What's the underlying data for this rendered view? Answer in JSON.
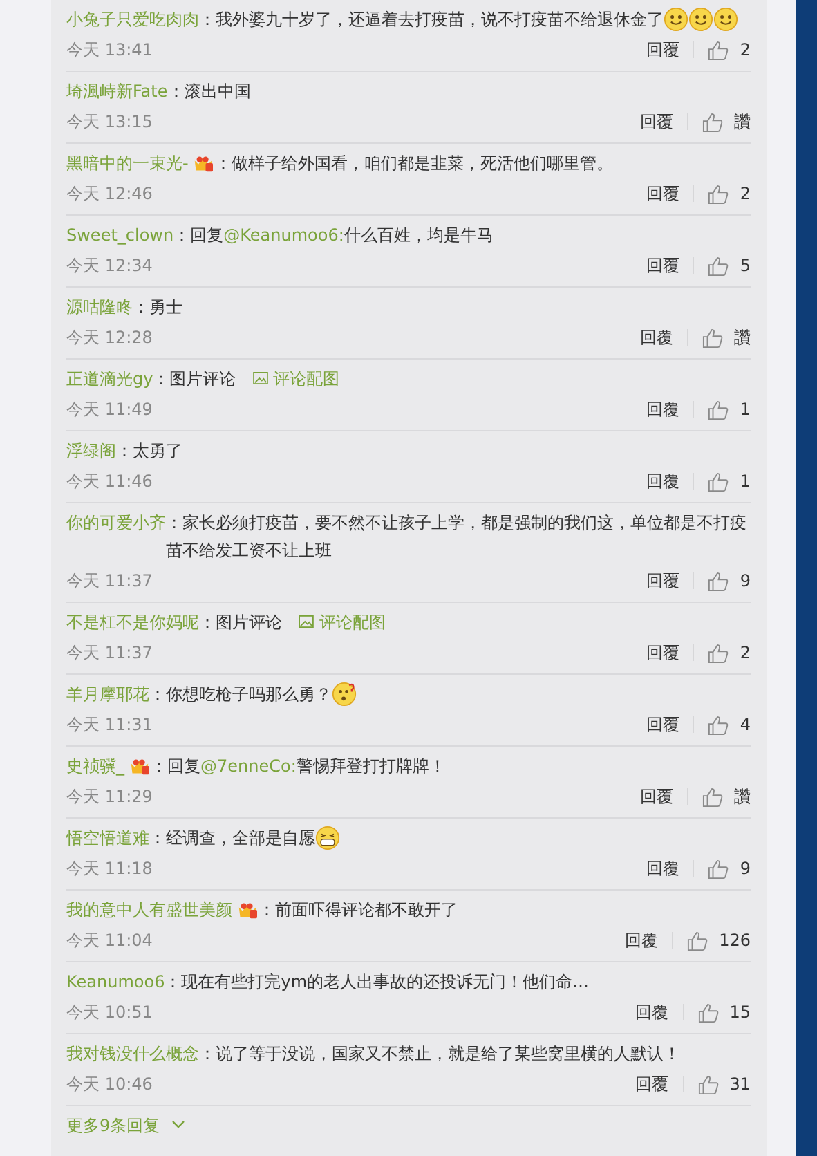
{
  "comments": [
    {
      "user": "小兔子只爱吃肉肉",
      "vip": false,
      "text": "：我外婆九十岁了，还逼着去打疫苗，说不打疫苗不给退休金了",
      "emojis": [
        {
          "kind": "smile"
        },
        {
          "kind": "smile"
        },
        {
          "kind": "smile"
        }
      ],
      "time": "今天 13:41",
      "reply": "回覆",
      "likes": "2"
    },
    {
      "user": "埼渢峙新Fate",
      "vip": false,
      "text": "：滚出中国",
      "time": "今天 13:15",
      "reply": "回覆",
      "likes": "讚"
    },
    {
      "user": "黑暗中的一束光-",
      "vip": true,
      "text": "：做样子给外国看，咱们都是韭菜，死活他们哪里管。",
      "time": "今天 12:46",
      "reply": "回覆",
      "likes": "2"
    },
    {
      "user": "Sweet_clown",
      "vip": false,
      "prefix": "：回复",
      "mention": "@Keanumoo6:",
      "text": "什么百姓，均是牛马",
      "time": "今天 12:34",
      "reply": "回覆",
      "likes": "5"
    },
    {
      "user": "源咕隆咚",
      "vip": false,
      "text": "：勇士",
      "time": "今天 12:28",
      "reply": "回覆",
      "likes": "讚"
    },
    {
      "user": "正道滴光gy",
      "vip": false,
      "text": "：图片评论",
      "image_link": "评论配图",
      "time": "今天 11:49",
      "reply": "回覆",
      "likes": "1"
    },
    {
      "user": "浮绿阁",
      "vip": false,
      "text": "：太勇了",
      "time": "今天 11:46",
      "reply": "回覆",
      "likes": "1"
    },
    {
      "user": "你的可爱小齐",
      "vip": false,
      "text": "：家长必须打疫苗，要不然不让孩子上学，都是强制的我们这，单位都是不打疫苗不给发工资不让上班",
      "time": "今天 11:37",
      "reply": "回覆",
      "likes": "9"
    },
    {
      "user": "不是杠不是你妈呢",
      "vip": false,
      "text": "：图片评论",
      "image_link": "评论配图",
      "time": "今天 11:37",
      "reply": "回覆",
      "likes": "2"
    },
    {
      "user": "羊月摩耶花",
      "vip": false,
      "text": "：你想吃枪子吗那么勇？",
      "emojis": [
        {
          "kind": "puzzled"
        }
      ],
      "time": "今天 11:31",
      "reply": "回覆",
      "likes": "4"
    },
    {
      "user": "史祯骥_",
      "vip": true,
      "prefix": "：回复",
      "mention": "@7enneCo:",
      "text": "警惕拜登打打牌牌！",
      "time": "今天 11:29",
      "reply": "回覆",
      "likes": "讚"
    },
    {
      "user": "悟空悟道难",
      "vip": false,
      "text": "：经调查，全部是自愿",
      "emojis": [
        {
          "kind": "grin"
        }
      ],
      "time": "今天 11:18",
      "reply": "回覆",
      "likes": "9"
    },
    {
      "user": "我的意中人有盛世美颜",
      "vip": true,
      "text": "：前面吓得评论都不敢开了",
      "time": "今天 11:04",
      "reply": "回覆",
      "likes": "126"
    },
    {
      "user": "Keanumoo6",
      "vip": false,
      "text": "：现在有些打完ym的老人出事故的还投诉无门！他们命…",
      "time": "今天 10:51",
      "reply": "回覆",
      "likes": "15"
    },
    {
      "user": "我对钱没什么概念",
      "vip": false,
      "text": "：说了等于没说，国家又不禁止，就是给了某些窝里横的人默认！",
      "time": "今天 10:46",
      "reply": "回覆",
      "likes": "31"
    }
  ],
  "more": "更多9条回复"
}
